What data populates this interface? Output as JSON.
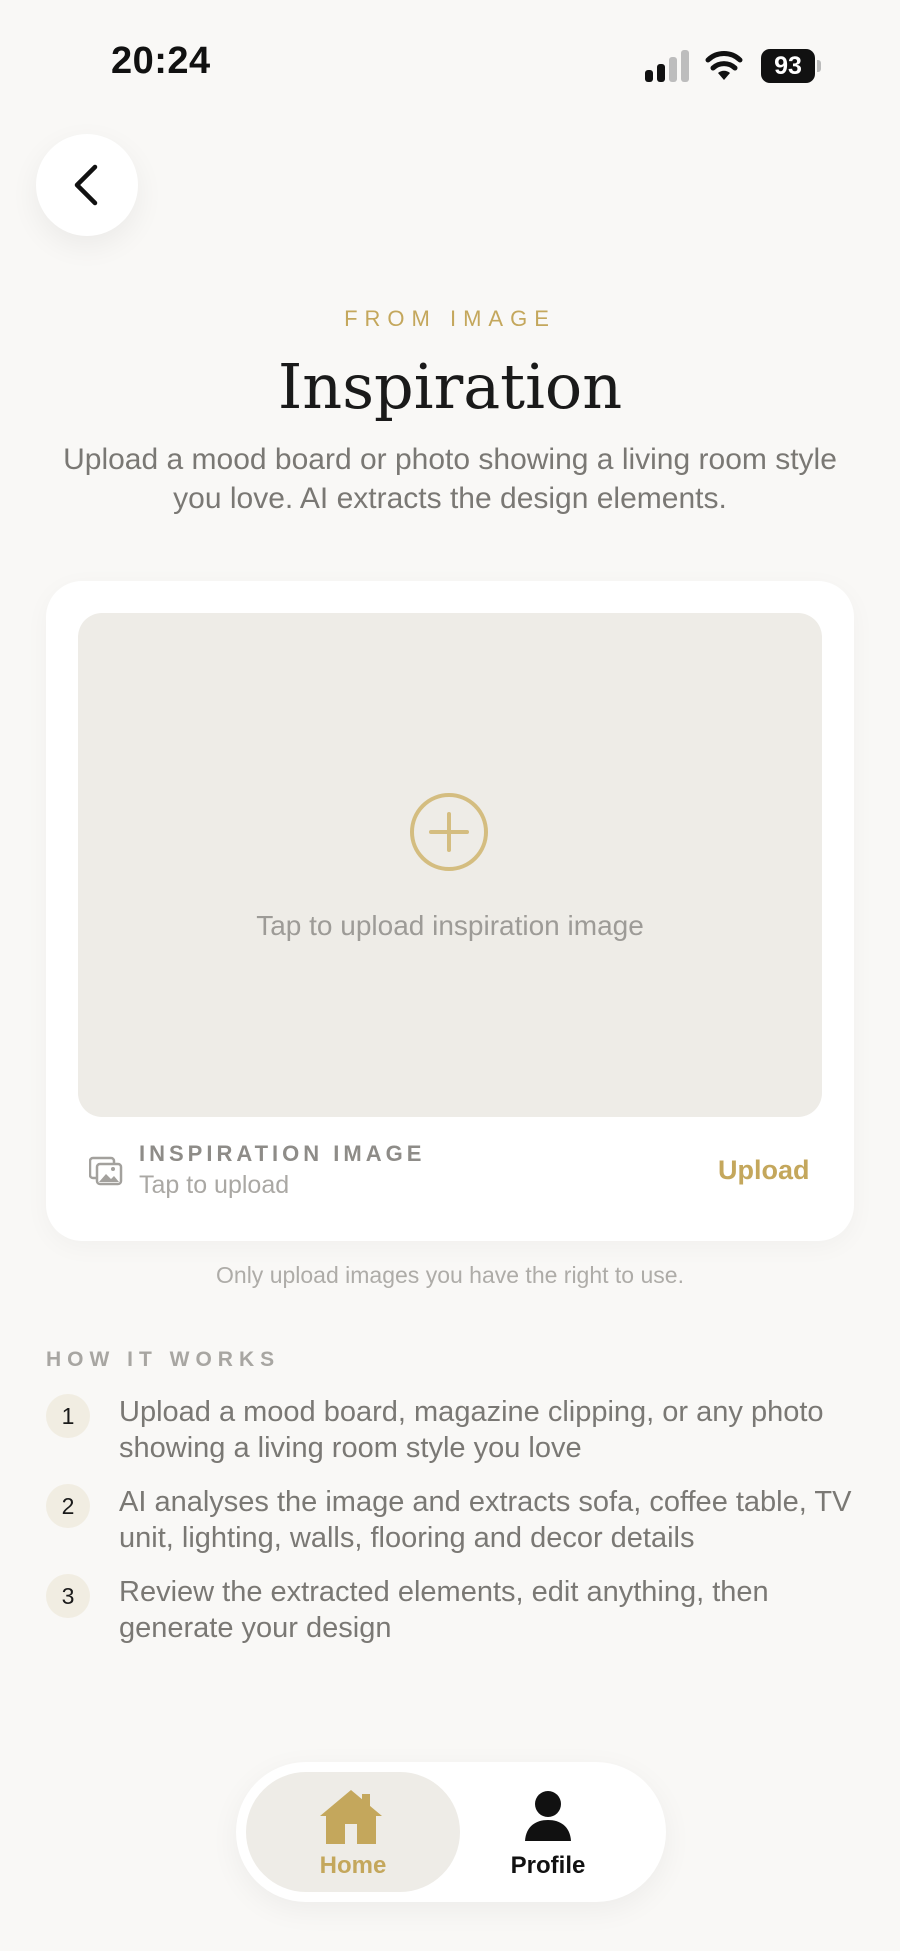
{
  "status_bar": {
    "time": "20:24",
    "battery": "93"
  },
  "header": {
    "back_icon": "chevron-left-icon",
    "eyebrow": "FROM IMAGE",
    "title": "Inspiration",
    "subtitle": "Upload a mood board or photo showing a living room style you love. AI extracts the design elements."
  },
  "upload_card": {
    "drop_label": "Tap to upload inspiration image",
    "plus_icon": "plus-circle-icon",
    "image_icon": "image-stack-icon",
    "label": "INSPIRATION IMAGE",
    "sub": "Tap to upload",
    "upload_link": "Upload"
  },
  "note": "Only upload images you have the right to use.",
  "how_it_works": {
    "heading": "HOW IT WORKS",
    "steps": [
      {
        "num": "1",
        "text": "Upload a mood board, magazine clipping, or any photo showing a living room style you love"
      },
      {
        "num": "2",
        "text": "AI analyses the image and extracts sofa, coffee table, TV unit, lighting, walls, flooring and decor details"
      },
      {
        "num": "3",
        "text": "Review the extracted elements, edit anything, then generate your design"
      }
    ]
  },
  "tab_bar": {
    "home": {
      "label": "Home",
      "icon": "home-icon",
      "active": true
    },
    "profile": {
      "label": "Profile",
      "icon": "person-icon",
      "active": false
    }
  },
  "colors": {
    "accent": "#c4a75c",
    "background": "#f9f8f6",
    "dropzone": "#eeece7",
    "muted_text": "#7a7874"
  }
}
